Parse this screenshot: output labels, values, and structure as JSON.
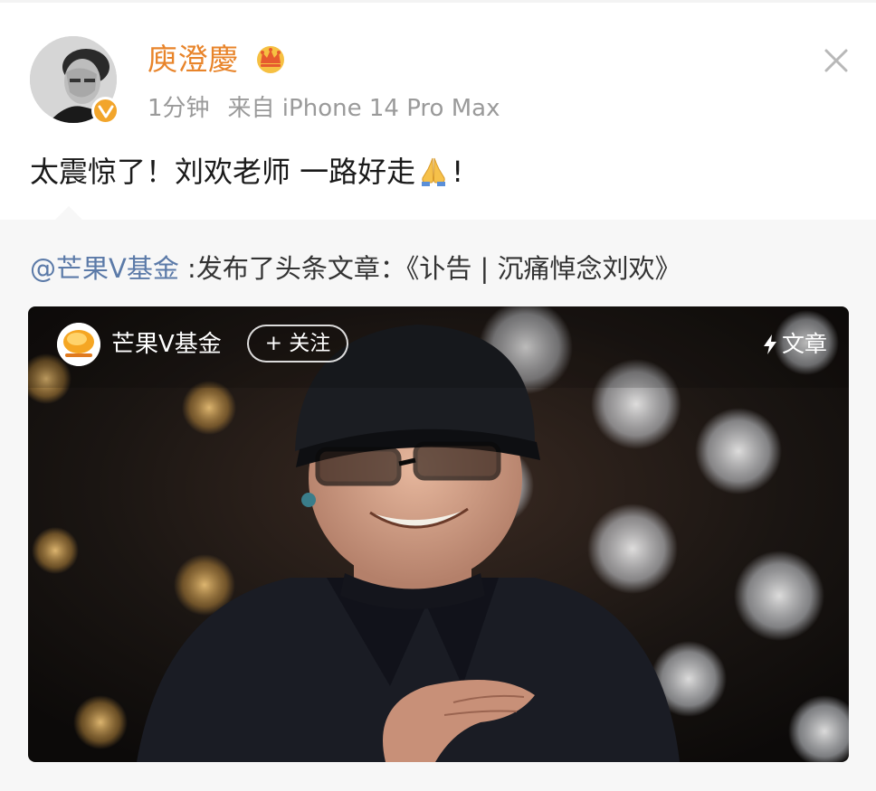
{
  "post": {
    "author": {
      "name": "庾澄慶",
      "avatar_icon": "avatar-photo",
      "verified_icon": "verified-badge-icon",
      "vip_icon": "crown-icon"
    },
    "time": "1分钟",
    "source": "来自 iPhone 14 Pro Max",
    "text": "太震惊了！刘欢老师 一路好走",
    "text_end": "!",
    "text_emoji": "pray-emoji",
    "close_icon": "close-icon"
  },
  "repost": {
    "mention": "@芒果V基金",
    "content": " :发布了头条文章：《讣告 | 沉痛悼念刘欢》"
  },
  "card": {
    "source_name": "芒果V基金",
    "follow_label": "+ 关注",
    "tag_label": "文章",
    "logo_icon": "mango-logo-icon",
    "image_description_icon": "article-cover-photo"
  },
  "colors": {
    "username": "#e8842a",
    "mention": "#5b7aa8",
    "meta": "#9a9a9a",
    "repost_bg": "#f7f7f7",
    "badge": "#f2a52b"
  }
}
